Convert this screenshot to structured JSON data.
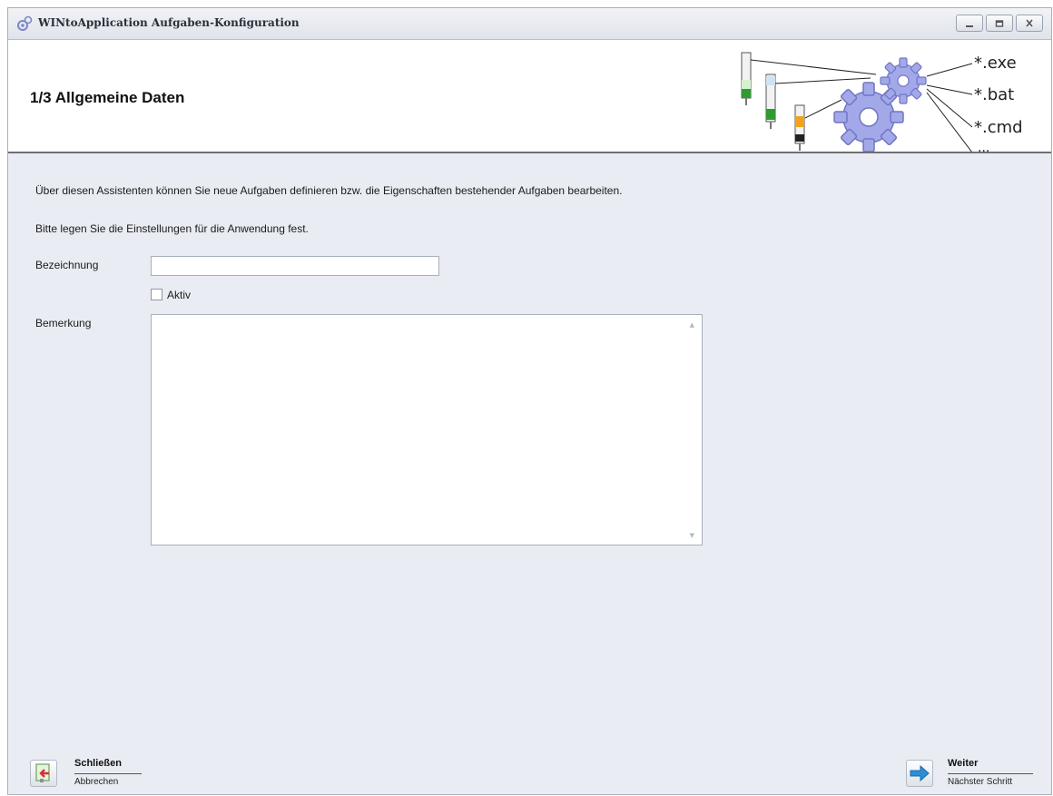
{
  "window": {
    "title": "WINtoApplication Aufgaben-Konfiguration",
    "controls": {
      "minimize": "minimize-icon",
      "maximize": "maximize-icon",
      "close": "close-icon"
    }
  },
  "header": {
    "step_title": "1/3 Allgemeine Daten",
    "graphic_labels": [
      "*.exe",
      "*.bat",
      "*.cmd",
      "..."
    ]
  },
  "main": {
    "intro": "Über diesen Assistenten können Sie neue Aufgaben definieren bzw. die Eigenschaften bestehender Aufgaben bearbeiten.",
    "instruction": "Bitte legen Sie die Einstellungen für die Anwendung fest.",
    "name_label": "Bezeichnung",
    "name_value": "",
    "active_label": "Aktiv",
    "active_checked": false,
    "remark_label": "Bemerkung",
    "remark_value": ""
  },
  "footer": {
    "close_button": {
      "title": "Schließen",
      "subtitle": "Abbrechen",
      "icon": "exit-icon"
    },
    "next_button": {
      "title": "Weiter",
      "subtitle": "Nächster Schritt",
      "icon": "arrow-right-icon"
    }
  },
  "colors": {
    "accent_blue": "#2b8fd8",
    "gear": "#9fa6e6",
    "header_border": "#6d6f73"
  }
}
